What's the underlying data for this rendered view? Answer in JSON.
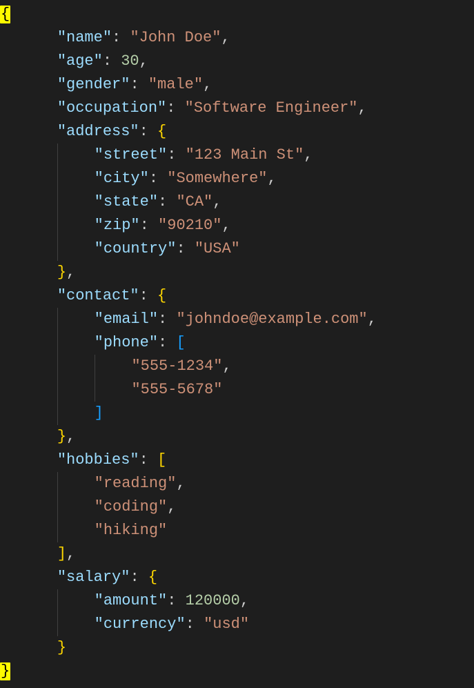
{
  "tokens": {
    "brace_open": "{",
    "brace_close": "}",
    "bracket_open": "[",
    "bracket_close": "]",
    "colon": ":",
    "comma": ",",
    "quote": "\"",
    "sp": " "
  },
  "keys": {
    "name": "\"name\"",
    "age": "\"age\"",
    "gender": "\"gender\"",
    "occupation": "\"occupation\"",
    "address": "\"address\"",
    "street": "\"street\"",
    "city": "\"city\"",
    "state": "\"state\"",
    "zip": "\"zip\"",
    "country": "\"country\"",
    "contact": "\"contact\"",
    "email": "\"email\"",
    "phone": "\"phone\"",
    "hobbies": "\"hobbies\"",
    "salary": "\"salary\"",
    "amount": "\"amount\"",
    "currency": "\"currency\""
  },
  "values": {
    "name": "\"John Doe\"",
    "age": "30",
    "gender": "\"male\"",
    "occupation": "\"Software Engineer\"",
    "street": "\"123 Main St\"",
    "city": "\"Somewhere\"",
    "state": "\"CA\"",
    "zip": "\"90210\"",
    "country": "\"USA\"",
    "email": "\"johndoe@example.com\"",
    "phone0": "\"555-1234\"",
    "phone1": "\"555-5678\"",
    "hobby0": "\"reading\"",
    "hobby1": "\"coding\"",
    "hobby2": "\"hiking\"",
    "amount": "120000",
    "currency": "\"usd\""
  },
  "json_document": {
    "name": "John Doe",
    "age": 30,
    "gender": "male",
    "occupation": "Software Engineer",
    "address": {
      "street": "123 Main St",
      "city": "Somewhere",
      "state": "CA",
      "zip": "90210",
      "country": "USA"
    },
    "contact": {
      "email": "johndoe@example.com",
      "phone": [
        "555-1234",
        "555-5678"
      ]
    },
    "hobbies": [
      "reading",
      "coding",
      "hiking"
    ],
    "salary": {
      "amount": 120000,
      "currency": "usd"
    }
  }
}
